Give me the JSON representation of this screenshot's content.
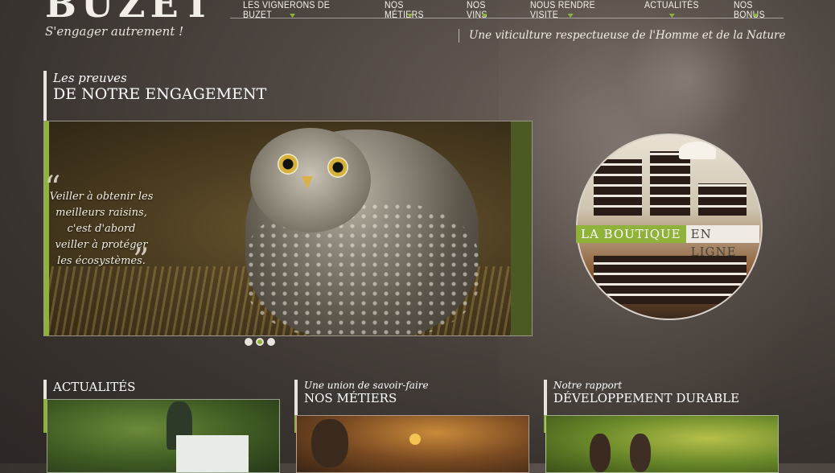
{
  "brand": {
    "logo": "BUZET",
    "tagline": "S'engager autrement !"
  },
  "nav": [
    "LES VIGNERONS DE BUZET",
    "NOS MÉTIERS",
    "NOS VINS",
    "NOUS RENDRE VISITE",
    "ACTUALITÉS",
    "NOS BONUS"
  ],
  "motto": "Une viticulture respectueuse de l'Homme et de la Nature",
  "engagement": {
    "subtitle": "Les preuves",
    "title": "DE NOTRE ENGAGEMENT"
  },
  "slider": {
    "quote": "Veiller à obtenir les meilleurs raisins, c'est d'abord veiller à protéger les écosystèmes.",
    "dots": 3,
    "active_dot": 2
  },
  "boutique": {
    "label_green": "LA BOUTIQUE",
    "label_white": "EN LIGNE"
  },
  "sections": [
    {
      "subtitle": "",
      "title": "ACTUALITÉS"
    },
    {
      "subtitle": "Une union de savoir-faire",
      "title": "NOS MÉTIERS"
    },
    {
      "subtitle": "Notre rapport",
      "title": "DÉVELOPPEMENT DURABLE"
    }
  ],
  "colors": {
    "accent": "#8fb23a",
    "bg": "#3a3430",
    "text": "#f4f1ea"
  }
}
